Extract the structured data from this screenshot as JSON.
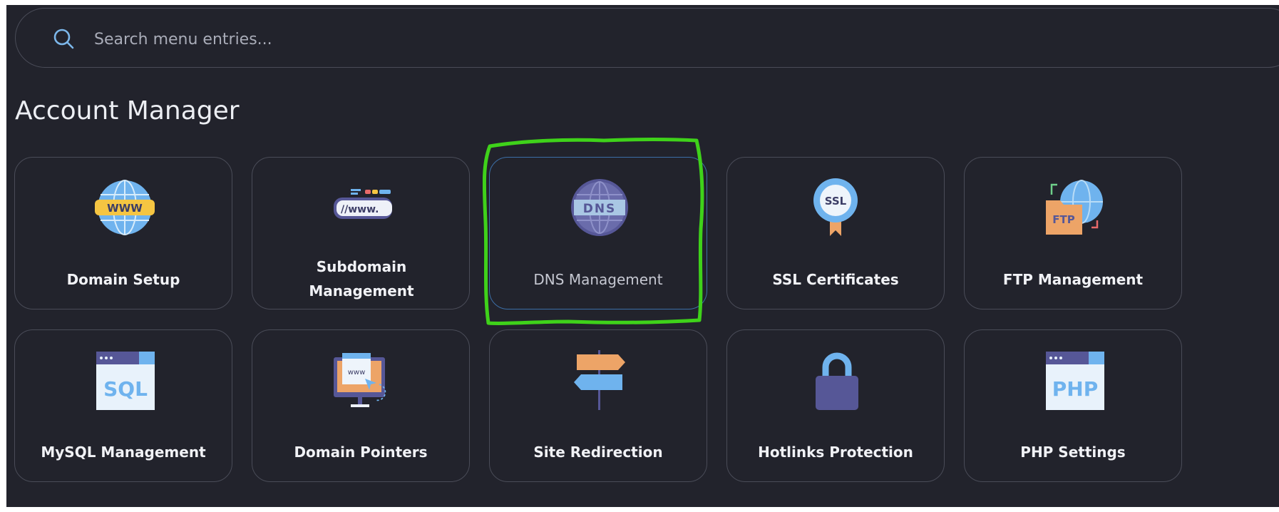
{
  "search": {
    "placeholder": "Search menu entries..."
  },
  "section": {
    "title": "Account Manager"
  },
  "tiles": [
    {
      "label": "Domain Setup",
      "icon": "www-globe-icon"
    },
    {
      "label": "Subdomain Management",
      "icon": "www-address-bar-icon"
    },
    {
      "label": "DNS Management",
      "icon": "dns-globe-icon",
      "active": true
    },
    {
      "label": "SSL Certificates",
      "icon": "ssl-badge-icon"
    },
    {
      "label": "FTP Management",
      "icon": "ftp-folder-icon"
    },
    {
      "label": "MySQL Management",
      "icon": "sql-window-icon"
    },
    {
      "label": "Domain Pointers",
      "icon": "monitor-www-icon"
    },
    {
      "label": "Site Redirection",
      "icon": "signpost-icon"
    },
    {
      "label": "Hotlinks Protection",
      "icon": "padlock-icon"
    },
    {
      "label": "PHP Settings",
      "icon": "php-window-icon"
    }
  ],
  "colors": {
    "background": "#22232c",
    "tile_border": "#4a4c58",
    "active_border": "#3c6fa8",
    "highlight_annotation": "#3fd21a",
    "accent_blue": "#6fb3ee",
    "icon_purple": "#565797",
    "icon_orange": "#eda467"
  }
}
